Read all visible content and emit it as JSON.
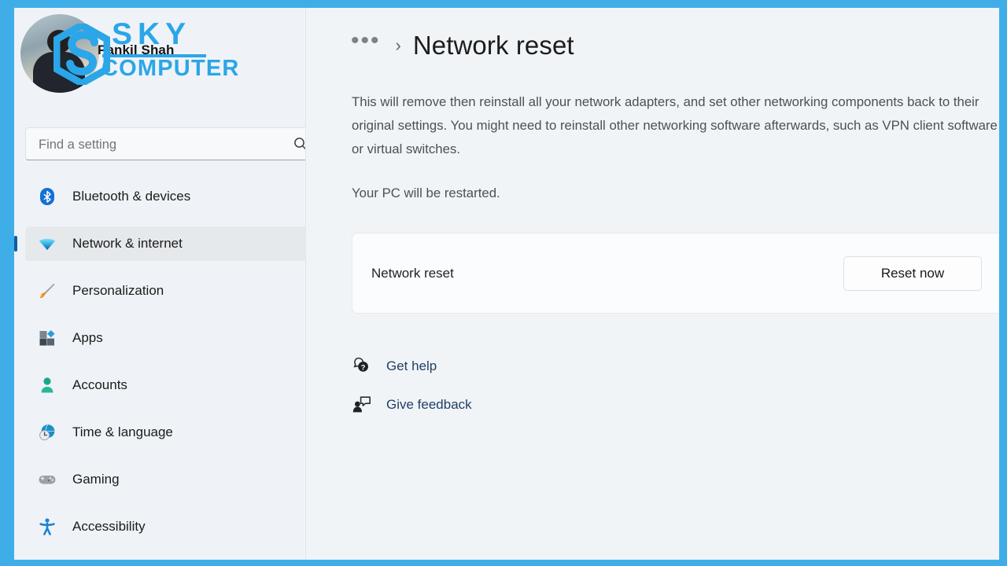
{
  "watermark": {
    "line1": "SKY",
    "line2": "COMPUTER",
    "logo_color": "#2BA6E8"
  },
  "frame": {
    "border_color": "#3FAEE8"
  },
  "sidebar": {
    "account_name": "Pankil Shah",
    "search": {
      "placeholder": "Find a setting",
      "value": "",
      "icon": "search-icon"
    },
    "items": [
      {
        "label": "Bluetooth & devices",
        "icon": "bluetooth-icon",
        "selected": false
      },
      {
        "label": "Network & internet",
        "icon": "wifi-icon",
        "selected": true
      },
      {
        "label": "Personalization",
        "icon": "paintbrush-icon",
        "selected": false
      },
      {
        "label": "Apps",
        "icon": "apps-icon",
        "selected": false
      },
      {
        "label": "Accounts",
        "icon": "person-icon",
        "selected": false
      },
      {
        "label": "Time & language",
        "icon": "clock-globe-icon",
        "selected": false
      },
      {
        "label": "Gaming",
        "icon": "gamepad-icon",
        "selected": false
      },
      {
        "label": "Accessibility",
        "icon": "accessibility-icon",
        "selected": false
      }
    ],
    "accent_color": "#0B5FA5"
  },
  "main": {
    "breadcrumb": {
      "ellipsis": "•••",
      "separator": "›"
    },
    "title": "Network reset",
    "description": "This will remove then reinstall all your network adapters, and set other networking components back to their original settings. You might need to reinstall other networking software afterwards, such as VPN client software or virtual switches.",
    "restart_note": "Your PC will be restarted.",
    "reset_card": {
      "label": "Network reset",
      "button_label": "Reset now"
    },
    "links": [
      {
        "label": "Get help",
        "icon": "help-question-icon"
      },
      {
        "label": "Give feedback",
        "icon": "feedback-person-icon"
      }
    ]
  }
}
